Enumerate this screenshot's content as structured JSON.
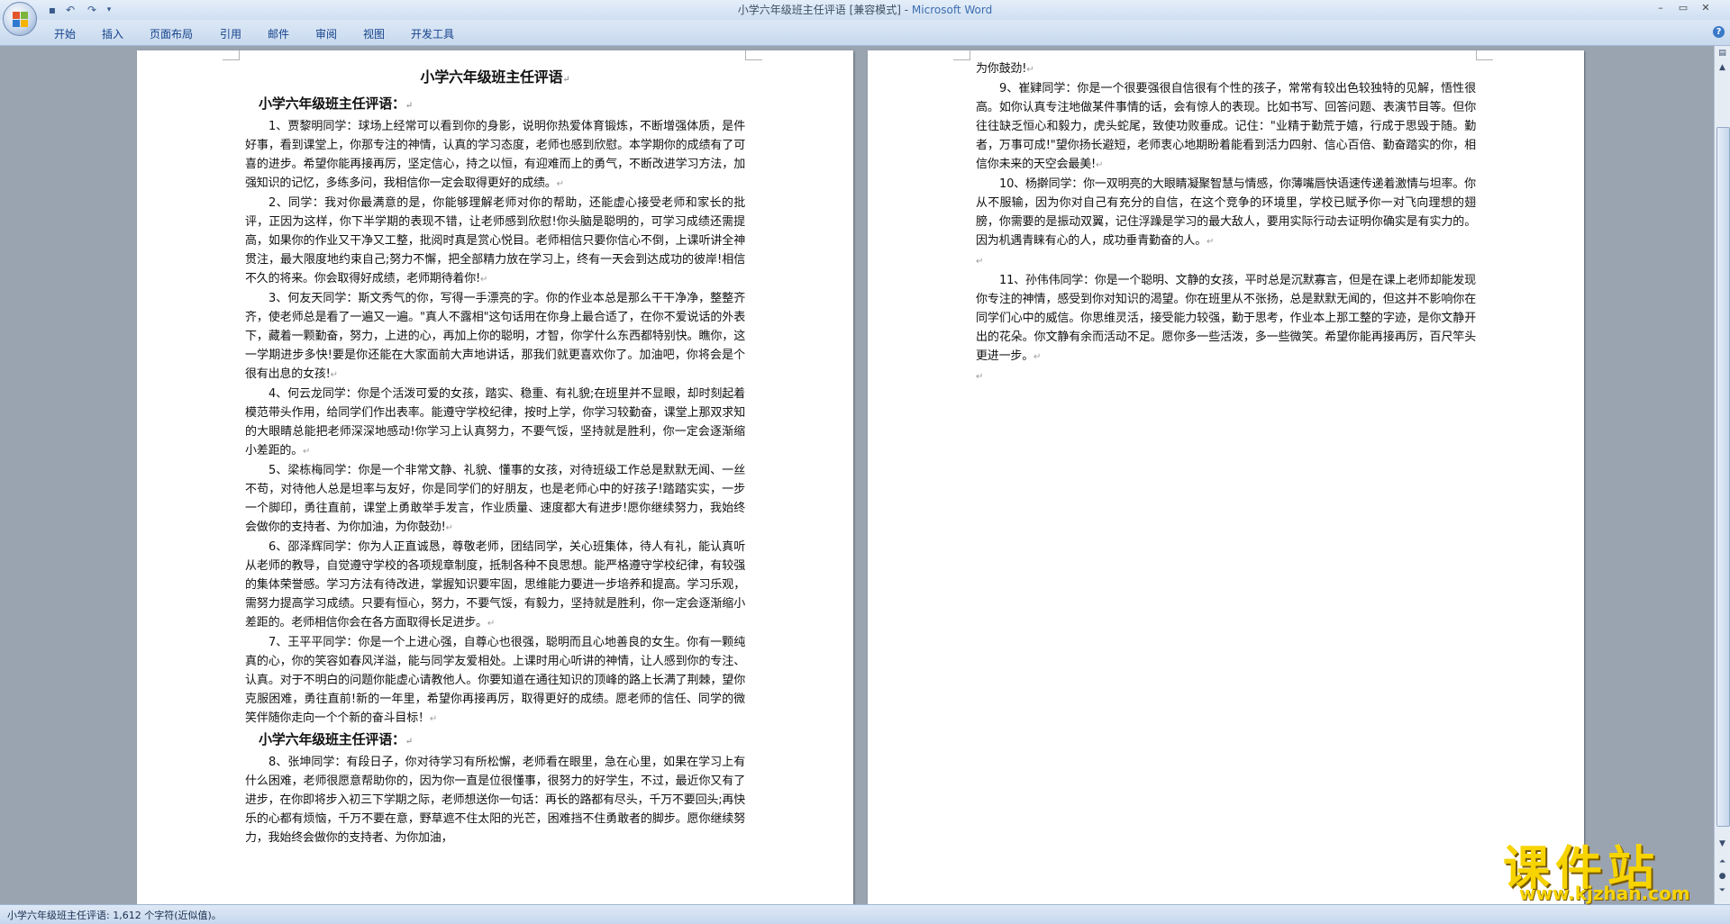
{
  "window": {
    "title_doc": "小学六年级班主任评语 [兼容模式] - ",
    "title_app": "Microsoft Word"
  },
  "ribbon_tabs": [
    "开始",
    "插入",
    "页面布局",
    "引用",
    "邮件",
    "审阅",
    "视图",
    "开发工具"
  ],
  "document": {
    "title": "小学六年级班主任评语",
    "section_title": "小学六年级班主任评语：",
    "page1_paragraphs": [
      "1、贾黎明同学：球场上经常可以看到你的身影，说明你热爱体育锻炼，不断增强体质，是件好事，看到课堂上，你那专注的神情，认真的学习态度，老师也感到欣慰。本学期你的成绩有了可喜的进步。希望你能再接再厉，坚定信心，持之以恒，有迎难而上的勇气，不断改进学习方法，加强知识的记忆，多练多问，我相信你一定会取得更好的成绩。",
      "2、同学：我对你最满意的是，你能够理解老师对你的帮助，还能虚心接受老师和家长的批评，正因为这样，你下半学期的表现不错，让老师感到欣慰!你头脑是聪明的，可学习成绩还需提高，如果你的作业又干净又工整，批阅时真是赏心悦目。老师相信只要你信心不倒，上课听讲全神贯注，最大限度地约束自己;努力不懈，把全部精力放在学习上，终有一天会到达成功的彼岸!相信不久的将来。你会取得好成绩，老师期待着你!",
      "3、何友天同学：斯文秀气的你，写得一手漂亮的字。你的作业本总是那么干干净净，整整齐齐，使老师总是看了一遍又一遍。\"真人不露相\"这句话用在你身上最合适了，在你不爱说话的外表下，藏着一颗勤奋，努力，上进的心，再加上你的聪明，才智，你学什么东西都特别快。瞧你，这一学期进步多快!要是你还能在大家面前大声地讲话，那我们就更喜欢你了。加油吧，你将会是个很有出息的女孩!",
      "4、何云龙同学：你是个活泼可爱的女孩，踏实、稳重、有礼貌;在班里并不显眼，却时刻起着模范带头作用，给同学们作出表率。能遵守学校纪律，按时上学，你学习较勤奋，课堂上那双求知的大眼睛总能把老师深深地感动!你学习上认真努力，不要气馁，坚持就是胜利，你一定会逐渐缩小差距的。",
      "5、梁栋梅同学：你是一个非常文静、礼貌、懂事的女孩，对待班级工作总是默默无闻、一丝不苟，对待他人总是坦率与友好，你是同学们的好朋友，也是老师心中的好孩子!踏踏实实，一步一个脚印，勇往直前，课堂上勇敢举手发言，作业质量、速度都大有进步!愿你继续努力，我始终会做你的支持者、为你加油，为你鼓劲!",
      "6、邵泽辉同学：你为人正直诚恳，尊敬老师，团结同学，关心班集体，待人有礼，能认真听从老师的教导，自觉遵守学校的各项规章制度，抵制各种不良思想。能严格遵守学校纪律，有较强的集体荣誉感。学习方法有待改进，掌握知识要牢固，思维能力要进一步培养和提高。学习乐观，需努力提高学习成绩。只要有恒心，努力，不要气馁，有毅力，坚持就是胜利，你一定会逐渐缩小差距的。老师相信你会在各方面取得长足进步。",
      "7、王平平同学：你是一个上进心强，自尊心也很强，聪明而且心地善良的女生。你有一颗纯真的心，你的笑容如春风洋溢，能与同学友爱相处。上课时用心听讲的神情，让人感到你的专注、认真。对于不明白的问题你能虚心请教他人。你要知道在通往知识的顶峰的路上长满了荆棘，望你克服困难，勇往直前!新的一年里，希望你再接再厉，取得更好的成绩。愿老师的信任、同学的微笑伴随你走向一个个新的奋斗目标！"
    ],
    "page1_section2_paragraph": "8、张坤同学：有段日子，你对待学习有所松懈，老师看在眼里，急在心里，如果在学习上有什么困难，老师很愿意帮助你的，因为你一直是位很懂事，很努力的好学生，不过，最近你又有了进步，在你即将步入初三下学期之际，老师想送你一句话：再长的路都有尽头，千万不要回头;再快乐的心都有烦恼，千万不要在意，野草遮不住太阳的光芒，困难挡不住勇敢者的脚步。愿你继续努力，我始终会做你的支持者、为你加油，",
    "page2_first_line": "为你鼓劲!",
    "page2_paragraphs": [
      "9、崔肄同学：你是一个很要强很自信很有个性的孩子，常常有较出色较独特的见解，悟性很高。如你认真专注地做某件事情的话，会有惊人的表现。比如书写、回答问题、表演节目等。但你往往缺乏恒心和毅力，虎头蛇尾，致使功败垂成。记住：\"业精于勤荒于嬉，行成于思毁于随。勤者，万事可成!\"望你扬长避短，老师衷心地期盼着能看到活力四射、信心百倍、勤奋踏实的你，相信你未来的天空会最美!",
      "10、杨擀同学：你一双明亮的大眼睛凝聚智慧与情感，你薄嘴唇快语速传递着激情与坦率。你从不服输，因为你对自己有充分的自信，在这个竞争的环境里，学校已赋予你一对飞向理想的翅膀，你需要的是振动双翼，记住浮躁是学习的最大敌人，要用实际行动去证明你确实是有实力的。因为机遇青睐有心的人，成功垂青勤奋的人。",
      "11、孙伟伟同学：你是一个聪明、文静的女孩，平时总是沉默寡言，但是在课上老师却能发现你专注的神情，感受到你对知识的渴望。你在班里从不张扬，总是默默无闻的，但这并不影响你在同学们心中的威信。你思维灵活，接受能力较强，勤于思考，作业本上那工整的字迹，是你文静开出的花朵。你文静有余而活动不足。愿你多一些活泼，多一些微笑。希望你能再接再厉，百尺竿头更进一步。"
    ]
  },
  "status": {
    "text": "小学六年级班主任评语: 1,612 个字符(近似值)。"
  },
  "watermark": {
    "main": "课件站",
    "url": "www.kjzhan.com"
  },
  "colors": {
    "ribbon_text": "#15428b",
    "app_title": "#3d6db0",
    "watermark": "#f7d400"
  }
}
